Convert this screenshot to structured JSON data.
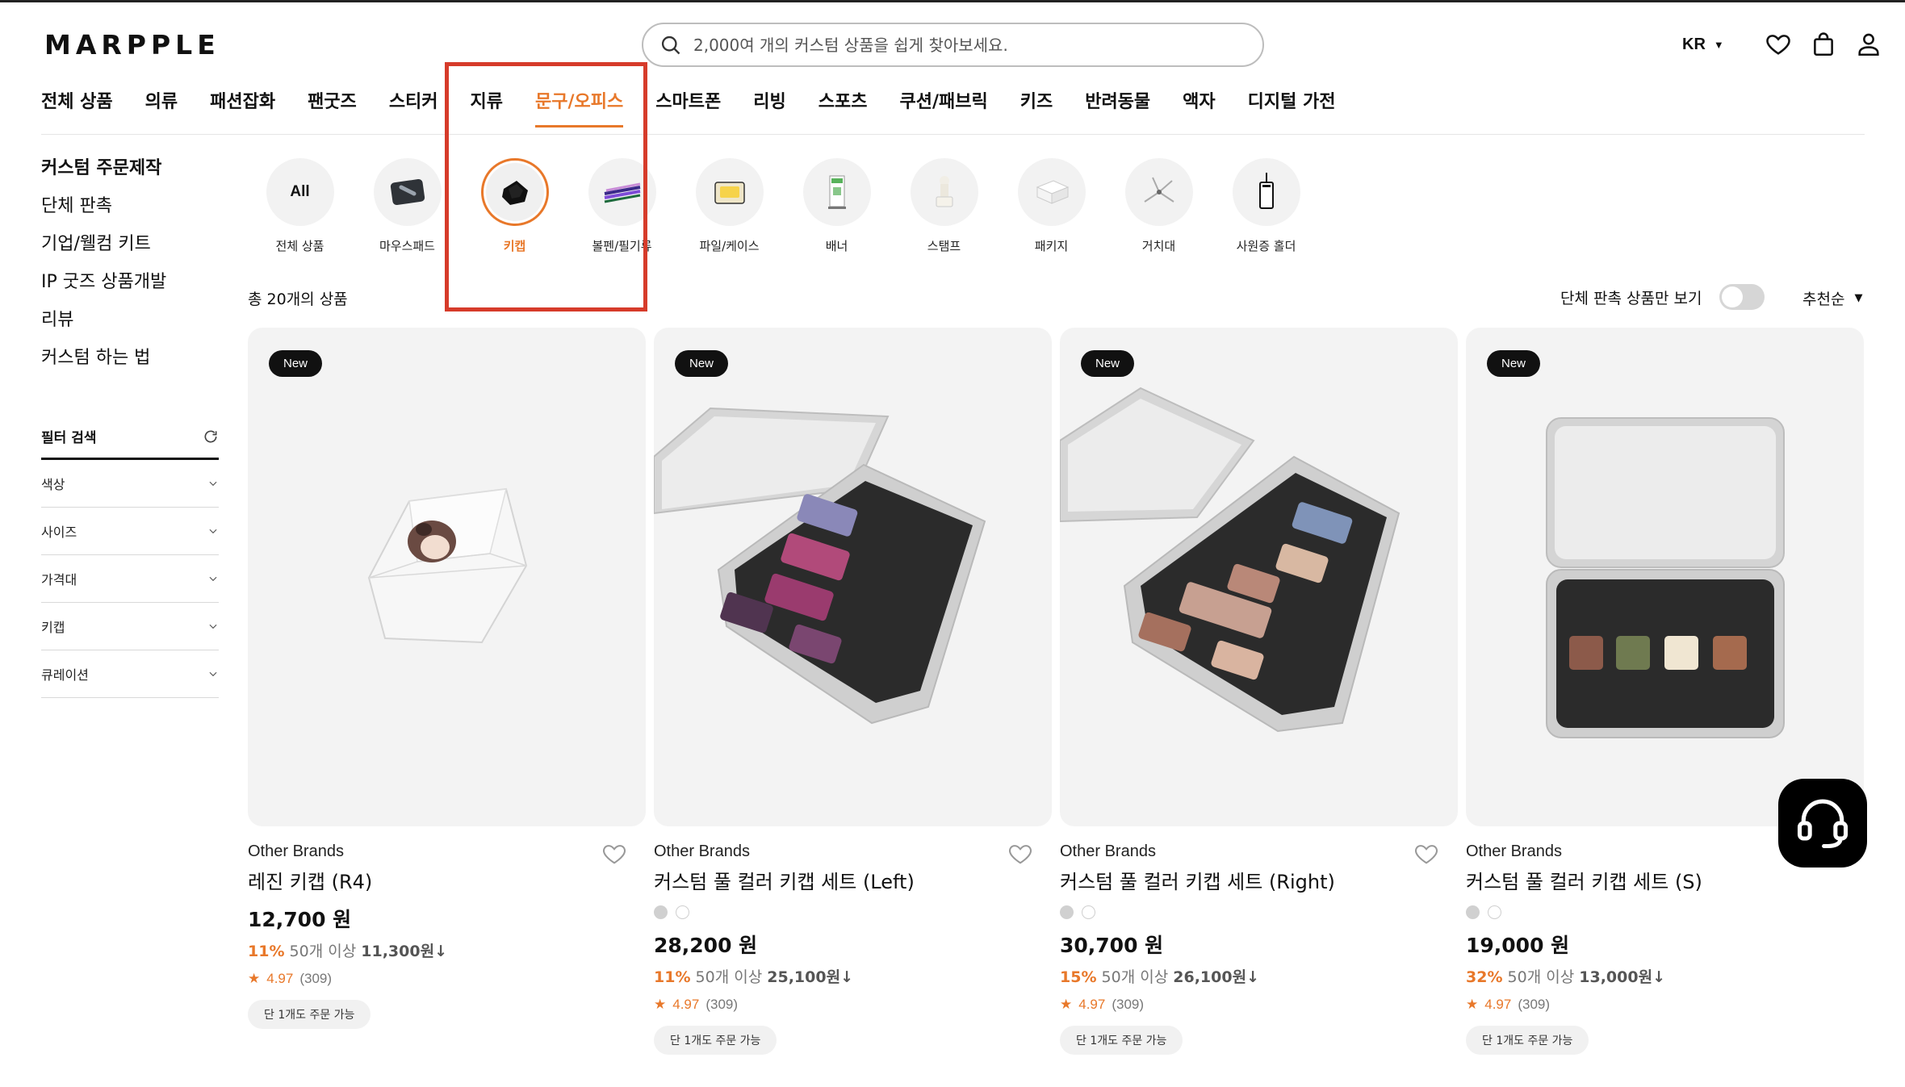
{
  "header": {
    "logo": "MARPPLE",
    "search_placeholder": "2,000여 개의 커스텀 상품을 쉽게 찾아보세요.",
    "lang": "KR",
    "icons": [
      "search-icon",
      "heart-icon",
      "shopping-bag-icon",
      "user-icon"
    ]
  },
  "nav": {
    "items": [
      "전체 상품",
      "의류",
      "패션잡화",
      "팬굿즈",
      "스티커",
      "지류",
      "문구/오피스",
      "스마트폰",
      "리빙",
      "스포츠",
      "쿠션/패브릭",
      "키즈",
      "반려동물",
      "액자",
      "디지털 가전"
    ],
    "active": "문구/오피스"
  },
  "sidebar": {
    "items": [
      "커스텀 주문제작",
      "단체 판촉",
      "기업/웰컴 키트",
      "IP 굿즈 상품개발",
      "리뷰",
      "커스텀 하는 법"
    ],
    "filter_title": "필터 검색",
    "filters": [
      "색상",
      "사이즈",
      "가격대",
      "키캡",
      "큐레이션"
    ]
  },
  "subcategories": {
    "all_text": "All",
    "items": [
      "전체 상품",
      "마우스패드",
      "키캡",
      "볼펜/필기류",
      "파일/케이스",
      "배너",
      "스탬프",
      "패키지",
      "거치대",
      "사원증 홀더"
    ],
    "active": "키캡"
  },
  "toolbar": {
    "count": "총 20개의 상품",
    "toggle_label": "단체 판촉 상품만 보기",
    "sort_label": "추천순"
  },
  "products": [
    {
      "badge": "New",
      "brand": "Other Brands",
      "name": "레진 키캡 (R4)",
      "price": "12,700 원",
      "discount_pct": "11%",
      "discount_text": "50개 이상",
      "bulk_price": "11,300원",
      "rating": "4.97",
      "reviews": "(309)",
      "chip": "단 1개도 주문 가능",
      "swatches": false
    },
    {
      "badge": "New",
      "brand": "Other Brands",
      "name": "커스텀 풀 컬러 키캡 세트 (Left)",
      "price": "28,200 원",
      "discount_pct": "11%",
      "discount_text": "50개 이상",
      "bulk_price": "25,100원",
      "rating": "4.97",
      "reviews": "(309)",
      "chip": "단 1개도 주문 가능",
      "swatches": true
    },
    {
      "badge": "New",
      "brand": "Other Brands",
      "name": "커스텀 풀 컬러 키캡 세트 (Right)",
      "price": "30,700 원",
      "discount_pct": "15%",
      "discount_text": "50개 이상",
      "bulk_price": "26,100원",
      "rating": "4.97",
      "reviews": "(309)",
      "chip": "단 1개도 주문 가능",
      "swatches": true
    },
    {
      "badge": "New",
      "brand": "Other Brands",
      "name": "커스텀 풀 컬러 키캡 세트 (S)",
      "price": "19,000 원",
      "discount_pct": "32%",
      "discount_text": "50개 이상",
      "bulk_price": "13,000원",
      "rating": "4.97",
      "reviews": "(309)",
      "chip": "단 1개도 주문 가능",
      "swatches": true
    }
  ],
  "colors": {
    "accent": "#e8782a",
    "highlight": "#d63b2a"
  },
  "chat_icon": "headset-icon"
}
